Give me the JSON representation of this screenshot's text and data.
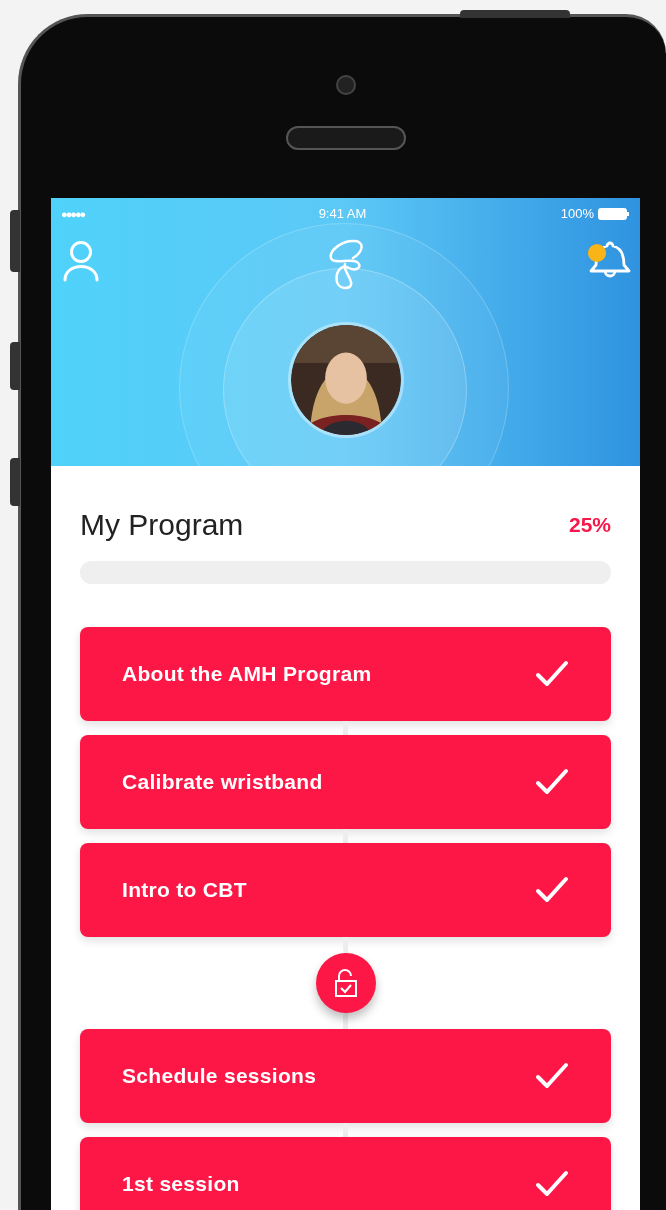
{
  "status_bar": {
    "signal": "●●●●●",
    "time": "9:41 AM",
    "battery": "100%"
  },
  "header": {
    "notification_unread": true
  },
  "program": {
    "title": "My Program",
    "percent": "25%"
  },
  "steps": [
    {
      "kind": "step",
      "label": "About the AMH Program",
      "completed": true
    },
    {
      "kind": "step",
      "label": "Calibrate wristband",
      "completed": true
    },
    {
      "kind": "step",
      "label": "Intro to CBT",
      "completed": true
    },
    {
      "kind": "unlock"
    },
    {
      "kind": "step",
      "label": "Schedule sessions",
      "completed": true
    },
    {
      "kind": "step",
      "label": "1st session",
      "completed": true
    }
  ]
}
